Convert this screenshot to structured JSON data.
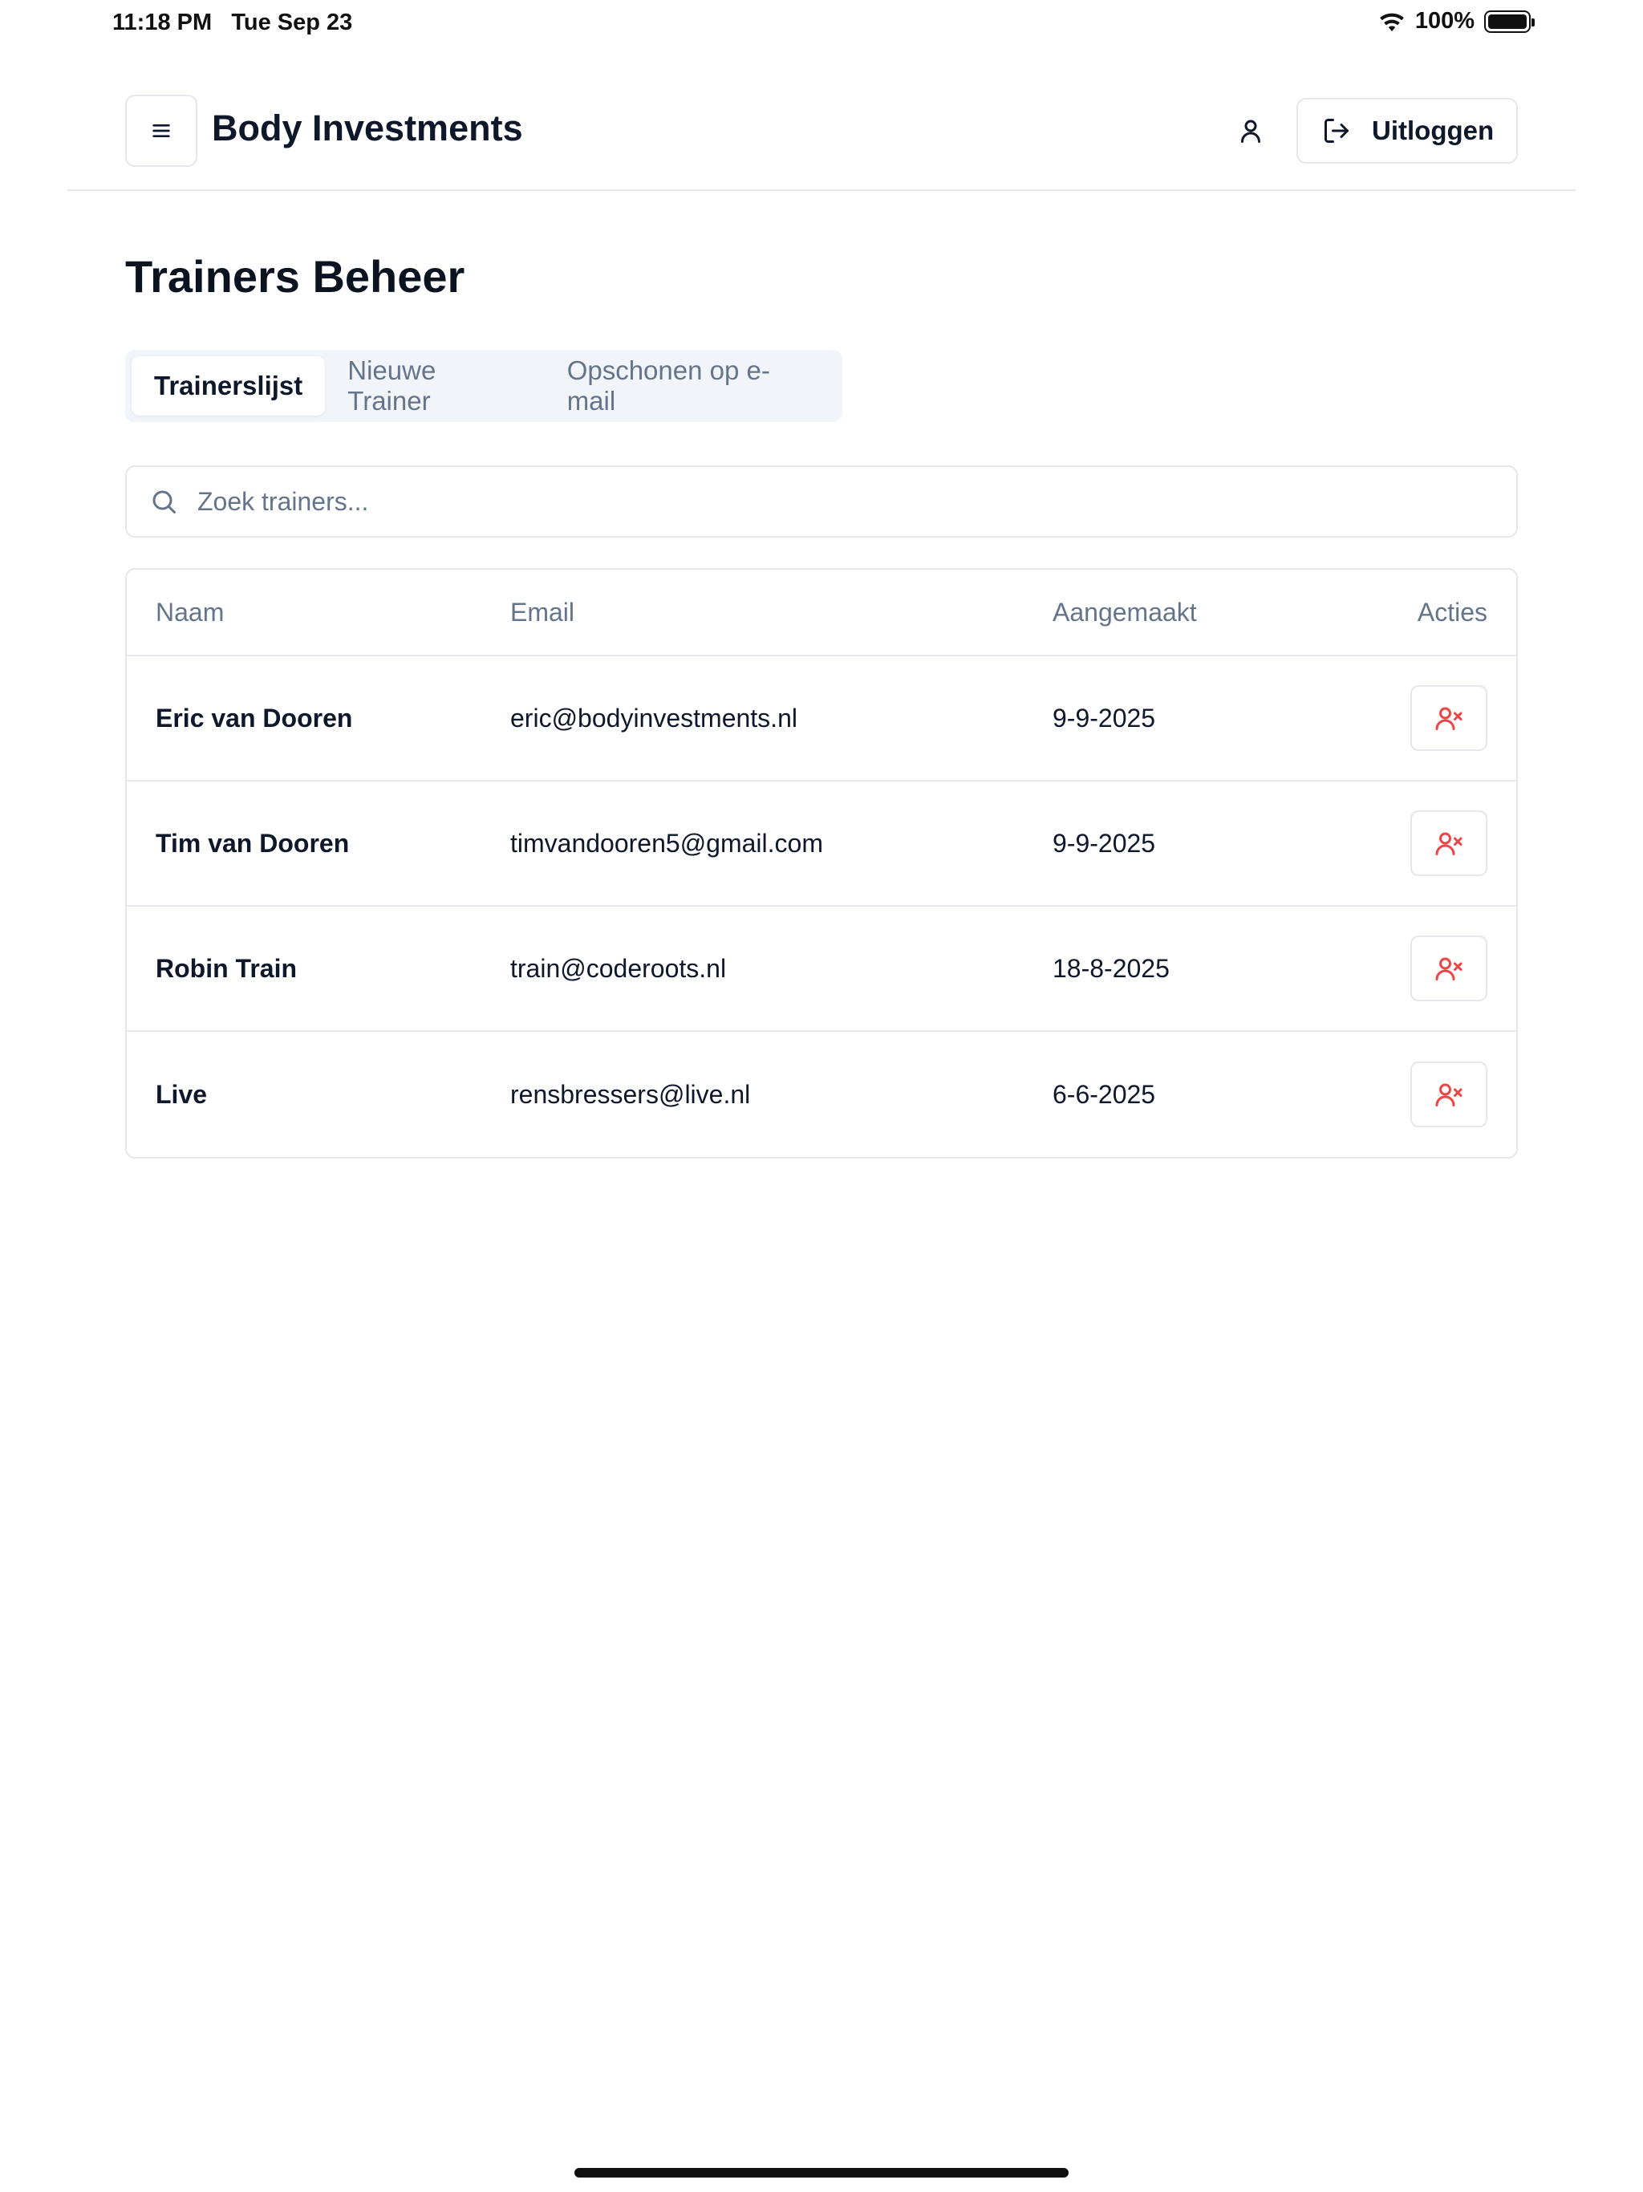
{
  "status_bar": {
    "time": "11:18 PM",
    "date": "Tue Sep 23",
    "battery": "100%"
  },
  "header": {
    "brand": "Body Investments",
    "logout_label": "Uitloggen"
  },
  "page": {
    "title": "Trainers Beheer"
  },
  "tabs": [
    {
      "label": "Trainerslijst",
      "active": true
    },
    {
      "label": "Nieuwe Trainer",
      "active": false
    },
    {
      "label": "Opschonen op e-mail",
      "active": false
    }
  ],
  "search": {
    "placeholder": "Zoek trainers...",
    "value": ""
  },
  "table": {
    "headers": {
      "name": "Naam",
      "email": "Email",
      "created": "Aangemaakt",
      "actions": "Acties"
    },
    "rows": [
      {
        "name": "Eric van Dooren",
        "email": "eric@bodyinvestments.nl",
        "created": "9-9-2025"
      },
      {
        "name": "Tim van Dooren",
        "email": "timvandooren5@gmail.com",
        "created": "9-9-2025"
      },
      {
        "name": "Robin Train",
        "email": "train@coderoots.nl",
        "created": "18-8-2025"
      },
      {
        "name": "Live",
        "email": "rensbressers@live.nl",
        "created": "6-6-2025"
      }
    ]
  },
  "icons": {
    "menu": "menu-icon",
    "user": "user-icon",
    "logout": "logout-icon",
    "search": "search-icon",
    "delete_user": "user-x-icon"
  },
  "colors": {
    "danger": "#ef4444",
    "muted_text": "#64748b",
    "border": "#e5e7eb",
    "tab_background": "#f1f5f9"
  }
}
